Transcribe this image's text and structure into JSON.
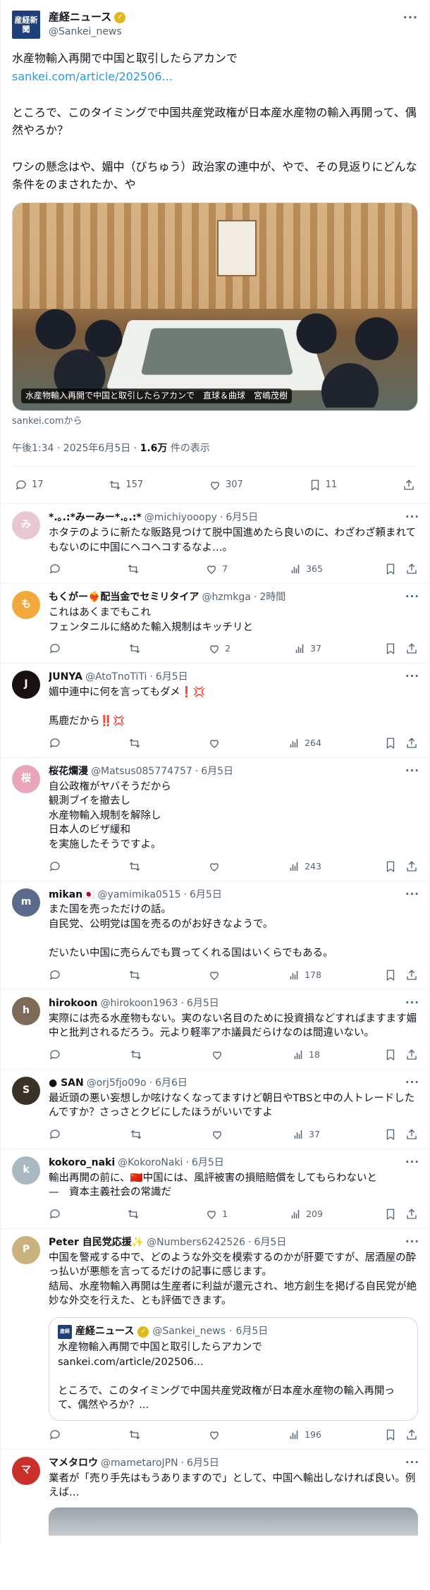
{
  "main_post": {
    "avatar_text": "産経新聞",
    "name": "産経ニュース",
    "handle": "@Sankei_news",
    "text_line1": "水産物輸入再開で中国と取引したらアカンで",
    "link": "sankei.com/article/202506...",
    "text_body": "ところで、このタイミングで中国共産党政権が日本産水産物の輸入再開って、偶然やろか？\n\nワシの懸念はや、媚中（びちゅう）政治家の連中が、やで、その見返りにどんな条件をのまされたか、や",
    "image_caption": "水産物輸入再開で中国と取引したらアカンで　直球＆曲球　宮嶋茂樹",
    "source": "sankei.comから",
    "time": "午後1:34 · 2025年6月5日 · ",
    "views_count": "1.6万",
    "views_label": " 件の表示",
    "stats": {
      "replies": "17",
      "reposts": "157",
      "likes": "307",
      "bookmarks": "11"
    }
  },
  "replies": [
    {
      "name": "*.｡.:*みーみー*.｡.:*",
      "handle": "@michiyooopy",
      "time": "6月5日",
      "text": "ホタテのように新たな販路見つけて脱中国進めたら良いのに、わざわざ頼まれてもないのに中国にヘコヘコするなよ…。",
      "replies": "",
      "reposts": "",
      "likes": "7",
      "views": "365",
      "avatar_color": "#e8c7d0",
      "avatar_text": "み"
    },
    {
      "name": "もくがー❤️‍🔥配当金でセミリタイア",
      "handle": "@hzmkga",
      "time": "2時間",
      "text": "これはあくまでもこれ\nフェンタニルに絡めた輸入規制はキッチリと",
      "replies": "",
      "reposts": "",
      "likes": "2",
      "views": "37",
      "avatar_color": "#f2a93b",
      "avatar_text": "も"
    },
    {
      "name": "JUNYA",
      "handle": "@AtoTnoTiTi",
      "time": "6月5日",
      "text": "媚中連中に何を言ってもダメ❗️💢\n\n馬鹿だから‼️💢",
      "replies": "",
      "reposts": "",
      "likes": "",
      "views": "264",
      "avatar_color": "#1a1010",
      "avatar_text": "J"
    },
    {
      "name": "桜花爛漫",
      "handle": "@Matsus085774757",
      "time": "6月5日",
      "text": "自公政権がヤバそうだから\n観測ブイを撤去し\n水産物輸入規制を解除し\n日本人のビザ緩和\nを実施したそうですよ。",
      "replies": "",
      "reposts": "",
      "likes": "",
      "views": "243",
      "avatar_color": "#e9a6b8",
      "avatar_text": "桜"
    },
    {
      "name": "mikan🇯🇵",
      "handle": "@yamimika0515",
      "time": "6月5日",
      "text": "また国を売っただけの話。\n自民党、公明党は国を売るのがお好きなようで。\n\nだいたい中国に売らんでも買ってくれる国はいくらでもある。",
      "replies": "",
      "reposts": "",
      "likes": "",
      "views": "178",
      "avatar_color": "#5b6b8c",
      "avatar_text": "m"
    },
    {
      "name": "hirokoon",
      "handle": "@hirokoon1963",
      "time": "6月5日",
      "text": "実際には売る水産物もない。実のない名目のために投資損などすればますます媚中と批判されるだろう。元より軽率アホ議員だらけなのは間違いない。",
      "replies": "",
      "reposts": "",
      "likes": "",
      "views": "18",
      "avatar_color": "#7d6a58",
      "avatar_text": "h"
    },
    {
      "name": "● SAN",
      "handle": "@orj5fjo09o",
      "time": "6月6日",
      "text": "最近頭の悪い妄想しか呟けなくなってますけど朝日やTBSと中の人トレードしたんですか？さっさとクビにしたほうがいいですよ",
      "replies": "",
      "reposts": "",
      "likes": "",
      "views": "37",
      "avatar_color": "#3a3226",
      "avatar_text": "S"
    },
    {
      "name": "kokoro_naki",
      "handle": "@KokoroNaki",
      "time": "6月5日",
      "text": "輸出再開の前に、🇨🇳中国には、風評被害の損賠賠償をしてもらわないと\n—　資本主義社会の常識だ",
      "replies": "",
      "reposts": "",
      "likes": "1",
      "views": "209",
      "avatar_color": "#aab8c2",
      "avatar_text": "k"
    },
    {
      "name": "Peter 自民党応援✨",
      "handle": "@Numbers6242526",
      "time": "6月5日",
      "text": "中国を警戒する中で、どのような外交を模索するのかが肝要ですが、居酒屋の酔っ払いが悪態を言ってるだけの記事に感じます。\n結局、水産物輸入再開は生産者に利益が還元され、地方創生を掲げる自民党が絶妙な外交を行えた、とも評価できます。",
      "replies": "",
      "reposts": "",
      "likes": "",
      "views": "196",
      "avatar_color": "#c9b27c",
      "avatar_text": "P"
    },
    {
      "name": "マメタロウ",
      "handle": "@mametaroJPN",
      "time": "6月5日",
      "text": "業者が「売り手先はもうありますので」として、中国へ輸出しなければ良い。例えば…",
      "replies": "",
      "reposts": "",
      "likes": "",
      "views": "",
      "avatar_color": "#c9302c",
      "avatar_text": "マ"
    }
  ],
  "quote": {
    "avatar_text": "産経",
    "name": "産経ニュース",
    "handle": "@Sankei_news",
    "time": "6月5日",
    "text": "水産物輸入再開で中国と取引したらアカンで\nsankei.com/article/202506...\n\nところで、このタイミングで中国共産党政権が日本産水産物の輸入再開って、偶然やろか？..."
  }
}
